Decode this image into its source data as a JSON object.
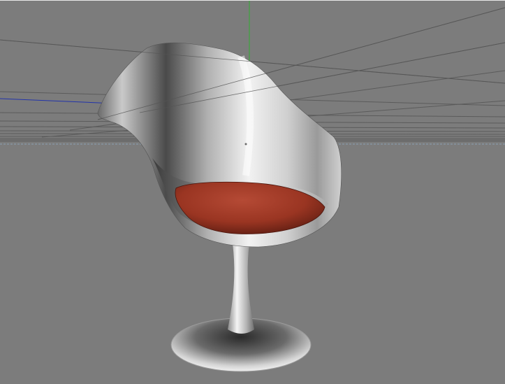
{
  "viewport": {
    "label": "",
    "colors": {
      "background": "#7c7c7c",
      "horizon_line": "#8aa0b4",
      "grid_lines": "#5a5a5a",
      "axis_x": "#c0392b",
      "axis_y": "#2fae2f",
      "axis_z": "#2233aa"
    }
  },
  "model": {
    "object": "tulip-armchair",
    "colors": {
      "shell": "#d8d8d8",
      "cushion": "#a33a28",
      "base": "#c9c9c9"
    }
  }
}
